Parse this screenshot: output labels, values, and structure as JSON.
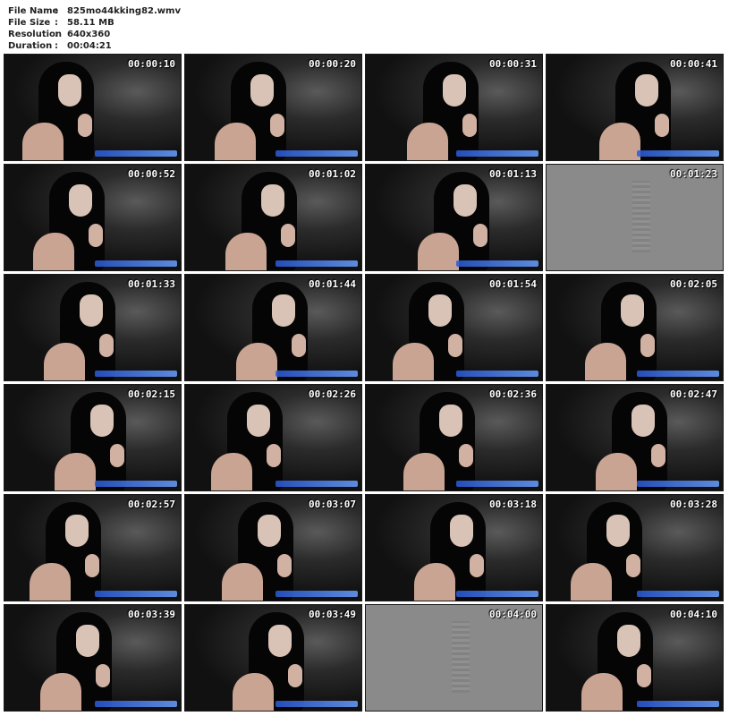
{
  "file_info": [
    {
      "label": "File Name",
      "value": "825mo44kking82.wmv"
    },
    {
      "label": "File Size",
      "value": "58.11 MB"
    },
    {
      "label": "Resolution",
      "value": "640x360"
    },
    {
      "label": "Duration",
      "value": "00:04:21"
    }
  ],
  "separator": ":",
  "thumbnails": [
    {
      "time": "00:00:10",
      "kind": "dark"
    },
    {
      "time": "00:00:20",
      "kind": "dark"
    },
    {
      "time": "00:00:31",
      "kind": "dark"
    },
    {
      "time": "00:00:41",
      "kind": "dark"
    },
    {
      "time": "00:00:52",
      "kind": "dark"
    },
    {
      "time": "00:01:02",
      "kind": "dark"
    },
    {
      "time": "00:01:13",
      "kind": "dark"
    },
    {
      "time": "00:01:23",
      "kind": "gray"
    },
    {
      "time": "00:01:33",
      "kind": "dark"
    },
    {
      "time": "00:01:44",
      "kind": "dark"
    },
    {
      "time": "00:01:54",
      "kind": "dark"
    },
    {
      "time": "00:02:05",
      "kind": "dark"
    },
    {
      "time": "00:02:15",
      "kind": "dark"
    },
    {
      "time": "00:02:26",
      "kind": "dark"
    },
    {
      "time": "00:02:36",
      "kind": "dark"
    },
    {
      "time": "00:02:47",
      "kind": "dark"
    },
    {
      "time": "00:02:57",
      "kind": "dark"
    },
    {
      "time": "00:03:07",
      "kind": "dark"
    },
    {
      "time": "00:03:18",
      "kind": "dark"
    },
    {
      "time": "00:03:28",
      "kind": "dark"
    },
    {
      "time": "00:03:39",
      "kind": "dark"
    },
    {
      "time": "00:03:49",
      "kind": "dark"
    },
    {
      "time": "00:04:00",
      "kind": "gray"
    },
    {
      "time": "00:04:10",
      "kind": "dark"
    }
  ]
}
